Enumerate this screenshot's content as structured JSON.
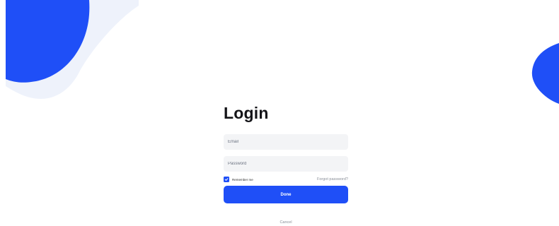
{
  "theme": {
    "accent": "#1f4ff7",
    "background": "#ffffff",
    "blob_light": "#eef2fb",
    "field_bg": "#f3f4f6"
  },
  "login": {
    "title": "Login",
    "email_placeholder": "Email",
    "password_placeholder": "Password",
    "remember_label": "Remember me",
    "remember_checked": true,
    "forgot_label": "Forgot password?",
    "done_label": "Done",
    "cancel_label": "Cancel"
  },
  "icons": {
    "checkbox": "checkmark-icon"
  }
}
